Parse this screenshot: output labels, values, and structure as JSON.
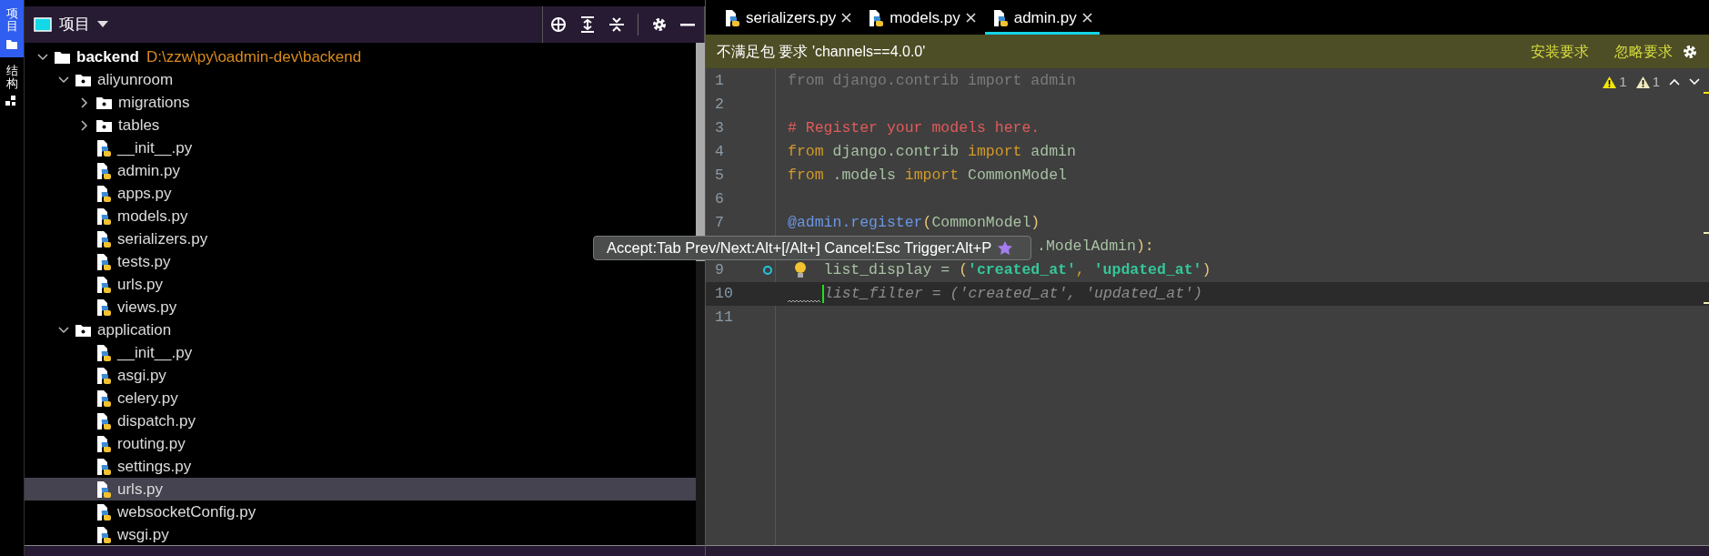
{
  "side_tabs": [
    {
      "label": "项目",
      "selected": true
    },
    {
      "label": "结构",
      "selected": false
    }
  ],
  "project_panel": {
    "title": "项目"
  },
  "tree": [
    {
      "kind": "root",
      "label": "backend",
      "path": "D:\\zzw\\py\\oadmin-dev\\backend",
      "expanded": true,
      "selected": false,
      "children": [
        {
          "kind": "folder",
          "label": "aliyunroom",
          "expanded": true,
          "selected": false,
          "children": [
            {
              "kind": "folder",
              "label": "migrations",
              "expanded": false,
              "selected": false
            },
            {
              "kind": "folder",
              "label": "tables",
              "expanded": false,
              "selected": false
            },
            {
              "kind": "file",
              "label": "__init__.py",
              "selected": false
            },
            {
              "kind": "file",
              "label": "admin.py",
              "selected": false
            },
            {
              "kind": "file",
              "label": "apps.py",
              "selected": false
            },
            {
              "kind": "file",
              "label": "models.py",
              "selected": false
            },
            {
              "kind": "file",
              "label": "serializers.py",
              "selected": false
            },
            {
              "kind": "file",
              "label": "tests.py",
              "selected": false
            },
            {
              "kind": "file",
              "label": "urls.py",
              "selected": false
            },
            {
              "kind": "file",
              "label": "views.py",
              "selected": false
            }
          ]
        },
        {
          "kind": "folder",
          "label": "application",
          "expanded": true,
          "selected": false,
          "children": [
            {
              "kind": "file",
              "label": "__init__.py",
              "selected": false
            },
            {
              "kind": "file",
              "label": "asgi.py",
              "selected": false
            },
            {
              "kind": "file",
              "label": "celery.py",
              "selected": false
            },
            {
              "kind": "file",
              "label": "dispatch.py",
              "selected": false
            },
            {
              "kind": "file",
              "label": "routing.py",
              "selected": false
            },
            {
              "kind": "file",
              "label": "settings.py",
              "selected": false
            },
            {
              "kind": "file",
              "label": "urls.py",
              "selected": true
            },
            {
              "kind": "file",
              "label": "websocketConfig.py",
              "selected": false
            },
            {
              "kind": "file",
              "label": "wsgi.py",
              "selected": false
            }
          ]
        }
      ]
    }
  ],
  "editor_tabs": [
    {
      "label": "serializers.py",
      "selected": false
    },
    {
      "label": "models.py",
      "selected": false
    },
    {
      "label": "admin.py",
      "selected": true
    }
  ],
  "banner": {
    "message": "不满足包 要求 'channels==4.0.0'",
    "actions": [
      "安装要求",
      "忽略要求"
    ]
  },
  "inspections": [
    {
      "color": "#f5e60a",
      "count": "1"
    },
    {
      "color": "#efe9bd",
      "count": "1"
    }
  ],
  "code_lines": [
    {
      "number": "1",
      "tokens": [
        {
          "kind": "unused",
          "text": "from django.contrib import admin"
        }
      ]
    },
    {
      "number": "2"
    },
    {
      "number": "3",
      "tokens": [
        {
          "kind": "comment",
          "text": "# Register your models here."
        }
      ]
    },
    {
      "number": "4",
      "tokens": [
        {
          "kind": "keyword",
          "text": "from"
        },
        {
          "kind": "ident",
          "text": " django.contrib "
        },
        {
          "kind": "keyword",
          "text": "import"
        },
        {
          "kind": "ident",
          "text": " admin"
        }
      ]
    },
    {
      "number": "5",
      "tokens": [
        {
          "kind": "keyword",
          "text": "from"
        },
        {
          "kind": "ident",
          "text": " .models "
        },
        {
          "kind": "keyword",
          "text": "import"
        },
        {
          "kind": "ident",
          "text": " CommonModel"
        }
      ]
    },
    {
      "number": "6"
    },
    {
      "number": "7",
      "tokens": [
        {
          "kind": "decorator",
          "text": "@admin.register"
        },
        {
          "kind": "punct",
          "text": "("
        },
        {
          "kind": "ident",
          "text": "CommonModel"
        },
        {
          "kind": "punct",
          "text": ")"
        }
      ]
    },
    {
      "covered": true,
      "tokens": [
        {
          "kind": "ident",
          "text": ".ModelAdmin"
        },
        {
          "kind": "punct",
          "text": "):"
        }
      ]
    },
    {
      "number": "9",
      "bulb": true,
      "tokens": [
        {
          "kind": "ident",
          "text": "list_display = "
        },
        {
          "kind": "punct",
          "text": "("
        },
        {
          "kind": "string",
          "text": "'created_at'"
        },
        {
          "kind": "keyword",
          "text": ", "
        },
        {
          "kind": "string",
          "text": "'updated_at'"
        },
        {
          "kind": "punct",
          "text": ")"
        }
      ]
    },
    {
      "number": "10",
      "current": true,
      "tokens": [
        {
          "kind": "squiggle"
        },
        {
          "kind": "caret"
        },
        {
          "kind": "ghost",
          "text": "list_filter = ('created_at', 'updated_at')"
        }
      ]
    },
    {
      "number": "11"
    }
  ],
  "tooltip": {
    "text": "Accept:Tab Prev/Next:Alt+[/Alt+] Cancel:Esc Trigger:Alt+P"
  }
}
